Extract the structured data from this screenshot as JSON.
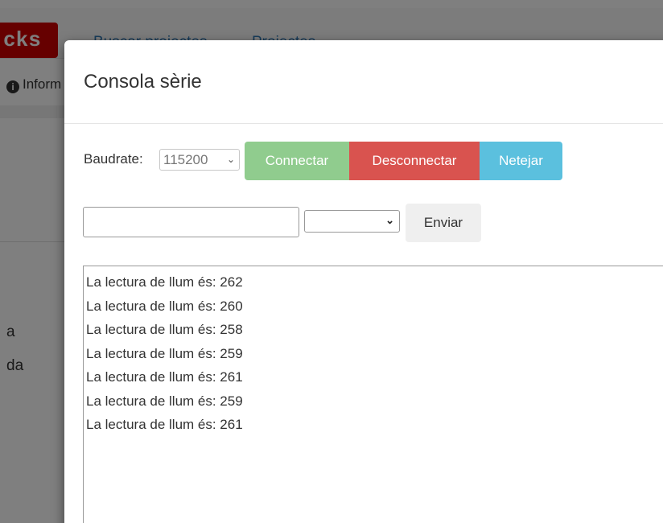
{
  "background": {
    "logo_text": "cks",
    "nav": {
      "search_projects": "Buscar projectes",
      "projects_menu": "Projectes",
      "projects_caret": "▾"
    },
    "info_label": "Inform",
    "side_text_1": "a",
    "side_text_2": "da"
  },
  "modal": {
    "title": "Consola sèrie",
    "baudrate_label": "Baudrate:",
    "baudrate_value": "115200",
    "buttons": {
      "connect": "Connectar",
      "disconnect": "Desconnectar",
      "clear": "Netejar",
      "send": "Enviar"
    },
    "message_input_value": "",
    "line_ending_value": "",
    "console_lines": [
      "La lectura de llum és: 262",
      "La lectura de llum és: 260",
      "La lectura de llum és: 258",
      "La lectura de llum és: 259",
      "La lectura de llum és: 261",
      "La lectura de llum és: 259",
      "La lectura de llum és: 261"
    ]
  },
  "colors": {
    "connect": "#90cc8e",
    "disconnect": "#d9534f",
    "clear": "#5bc0de",
    "logo": "#cc0000",
    "link": "#337ab7"
  }
}
